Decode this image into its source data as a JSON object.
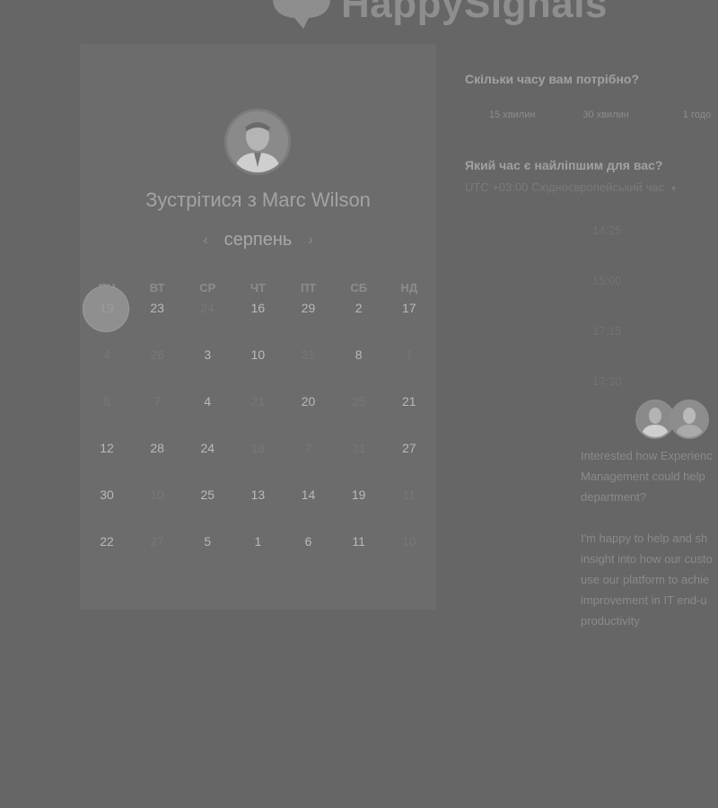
{
  "brand": {
    "name": "HappySignals"
  },
  "calendar": {
    "title": "Зустрітися з Marc Wilson",
    "month": "серпень",
    "weekdays": [
      "ПН",
      "ВТ",
      "СР",
      "ЧТ",
      "ПТ",
      "СБ",
      "НД"
    ],
    "rows": [
      [
        {
          "d": "19",
          "state": "selected"
        },
        {
          "d": "23",
          "state": "active"
        },
        {
          "d": "24",
          "state": "dim"
        },
        {
          "d": "16",
          "state": "active"
        },
        {
          "d": "29",
          "state": "active"
        },
        {
          "d": "2",
          "state": "active"
        },
        {
          "d": "17",
          "state": "active"
        }
      ],
      [
        {
          "d": "4",
          "state": "dim"
        },
        {
          "d": "26",
          "state": "dim"
        },
        {
          "d": "3",
          "state": "active"
        },
        {
          "d": "10",
          "state": "active"
        },
        {
          "d": "31",
          "state": "dim"
        },
        {
          "d": "8",
          "state": "active"
        },
        {
          "d": "1",
          "state": "dim"
        }
      ],
      [
        {
          "d": "8",
          "state": "dim"
        },
        {
          "d": "7",
          "state": "dim"
        },
        {
          "d": "4",
          "state": "active"
        },
        {
          "d": "21",
          "state": "dim"
        },
        {
          "d": "20",
          "state": "active"
        },
        {
          "d": "25",
          "state": "dim"
        },
        {
          "d": "21",
          "state": "active"
        }
      ],
      [
        {
          "d": "12",
          "state": "active"
        },
        {
          "d": "28",
          "state": "active"
        },
        {
          "d": "24",
          "state": "active"
        },
        {
          "d": "18",
          "state": "dim"
        },
        {
          "d": "7",
          "state": "dim"
        },
        {
          "d": "31",
          "state": "dim"
        },
        {
          "d": "27",
          "state": "active"
        }
      ],
      [
        {
          "d": "30",
          "state": "active"
        },
        {
          "d": "10",
          "state": "dim"
        },
        {
          "d": "25",
          "state": "active"
        },
        {
          "d": "13",
          "state": "active"
        },
        {
          "d": "14",
          "state": "active"
        },
        {
          "d": "19",
          "state": "active"
        },
        {
          "d": "11",
          "state": "dim"
        }
      ],
      [
        {
          "d": "22",
          "state": "active"
        },
        {
          "d": "27",
          "state": "dim"
        },
        {
          "d": "5",
          "state": "active"
        },
        {
          "d": "1",
          "state": "active"
        },
        {
          "d": "6",
          "state": "active"
        },
        {
          "d": "11",
          "state": "active"
        },
        {
          "d": "10",
          "state": "dim"
        }
      ]
    ]
  },
  "duration": {
    "question": "Скільки часу вам потрібно?",
    "options": [
      "15 хвилин",
      "30 хвилин",
      "1 годо"
    ]
  },
  "time": {
    "question": "Який час є найліпшим для вас?",
    "timezone": "UTC +03:00 Східноєвропейський час",
    "slots": [
      "14:25",
      "15:00",
      "17:15",
      "17:30"
    ]
  },
  "message": {
    "para1": "Interested how Experienc\nManagement could help\ndepartment?",
    "para2": "I'm happy to help and sh\ninsight into how our custo\nuse our platform to achie\nimprovement in IT end-u\nproductivity"
  }
}
